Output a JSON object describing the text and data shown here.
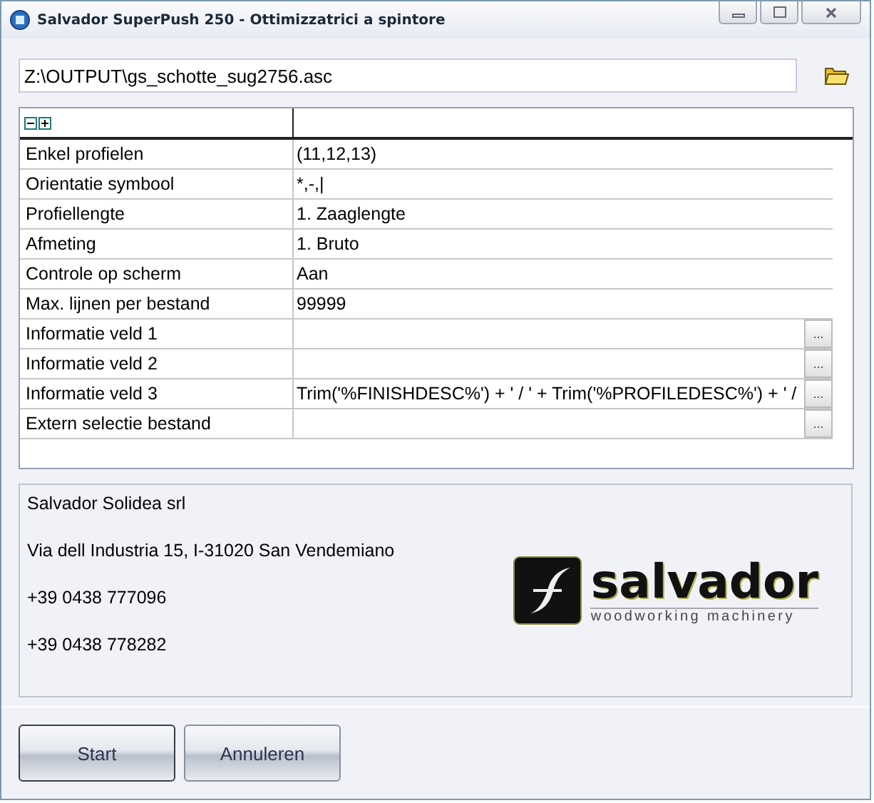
{
  "window": {
    "title": "Salvador SuperPush 250 - Ottimizzatrici a spintore"
  },
  "path_field": {
    "value": "Z:\\OUTPUT\\gs_schotte_sug2756.asc"
  },
  "grid": {
    "rows": [
      {
        "kind": "text",
        "label": "Enkel profielen",
        "value": "(11,12,13)"
      },
      {
        "kind": "text",
        "label": "Orientatie symbool",
        "value": "*,-,|"
      },
      {
        "kind": "text",
        "label": "Profiellengte",
        "value": "1. Zaaglengte"
      },
      {
        "kind": "text",
        "label": "Afmeting",
        "value": "1. Bruto"
      },
      {
        "kind": "text",
        "label": "Controle op scherm",
        "value": "Aan"
      },
      {
        "kind": "text",
        "label": "Max. lijnen per bestand",
        "value": "99999"
      },
      {
        "kind": "browse",
        "label": "Informatie veld 1",
        "button": "..."
      },
      {
        "kind": "browse",
        "label": "Informatie veld 2",
        "button": "..."
      },
      {
        "kind": "browse",
        "label": "Informatie veld 3",
        "value": "Trim('%FINISHDESC%') + ' / ' + Trim('%PROFILEDESC%') + ' /",
        "button": "..."
      },
      {
        "kind": "browse",
        "label": "Extern selectie bestand",
        "button": "..."
      }
    ]
  },
  "info": {
    "lines": [
      "Salvador Solidea srl",
      "Via dell Industria 15, I-31020 San Vendemiano",
      "+39 0438 777096",
      "+39 0438 778282"
    ],
    "logo": {
      "wordmark": "salvador",
      "tagline": "woodworking machinery"
    }
  },
  "buttons": [
    "Start",
    "Annuleren"
  ]
}
